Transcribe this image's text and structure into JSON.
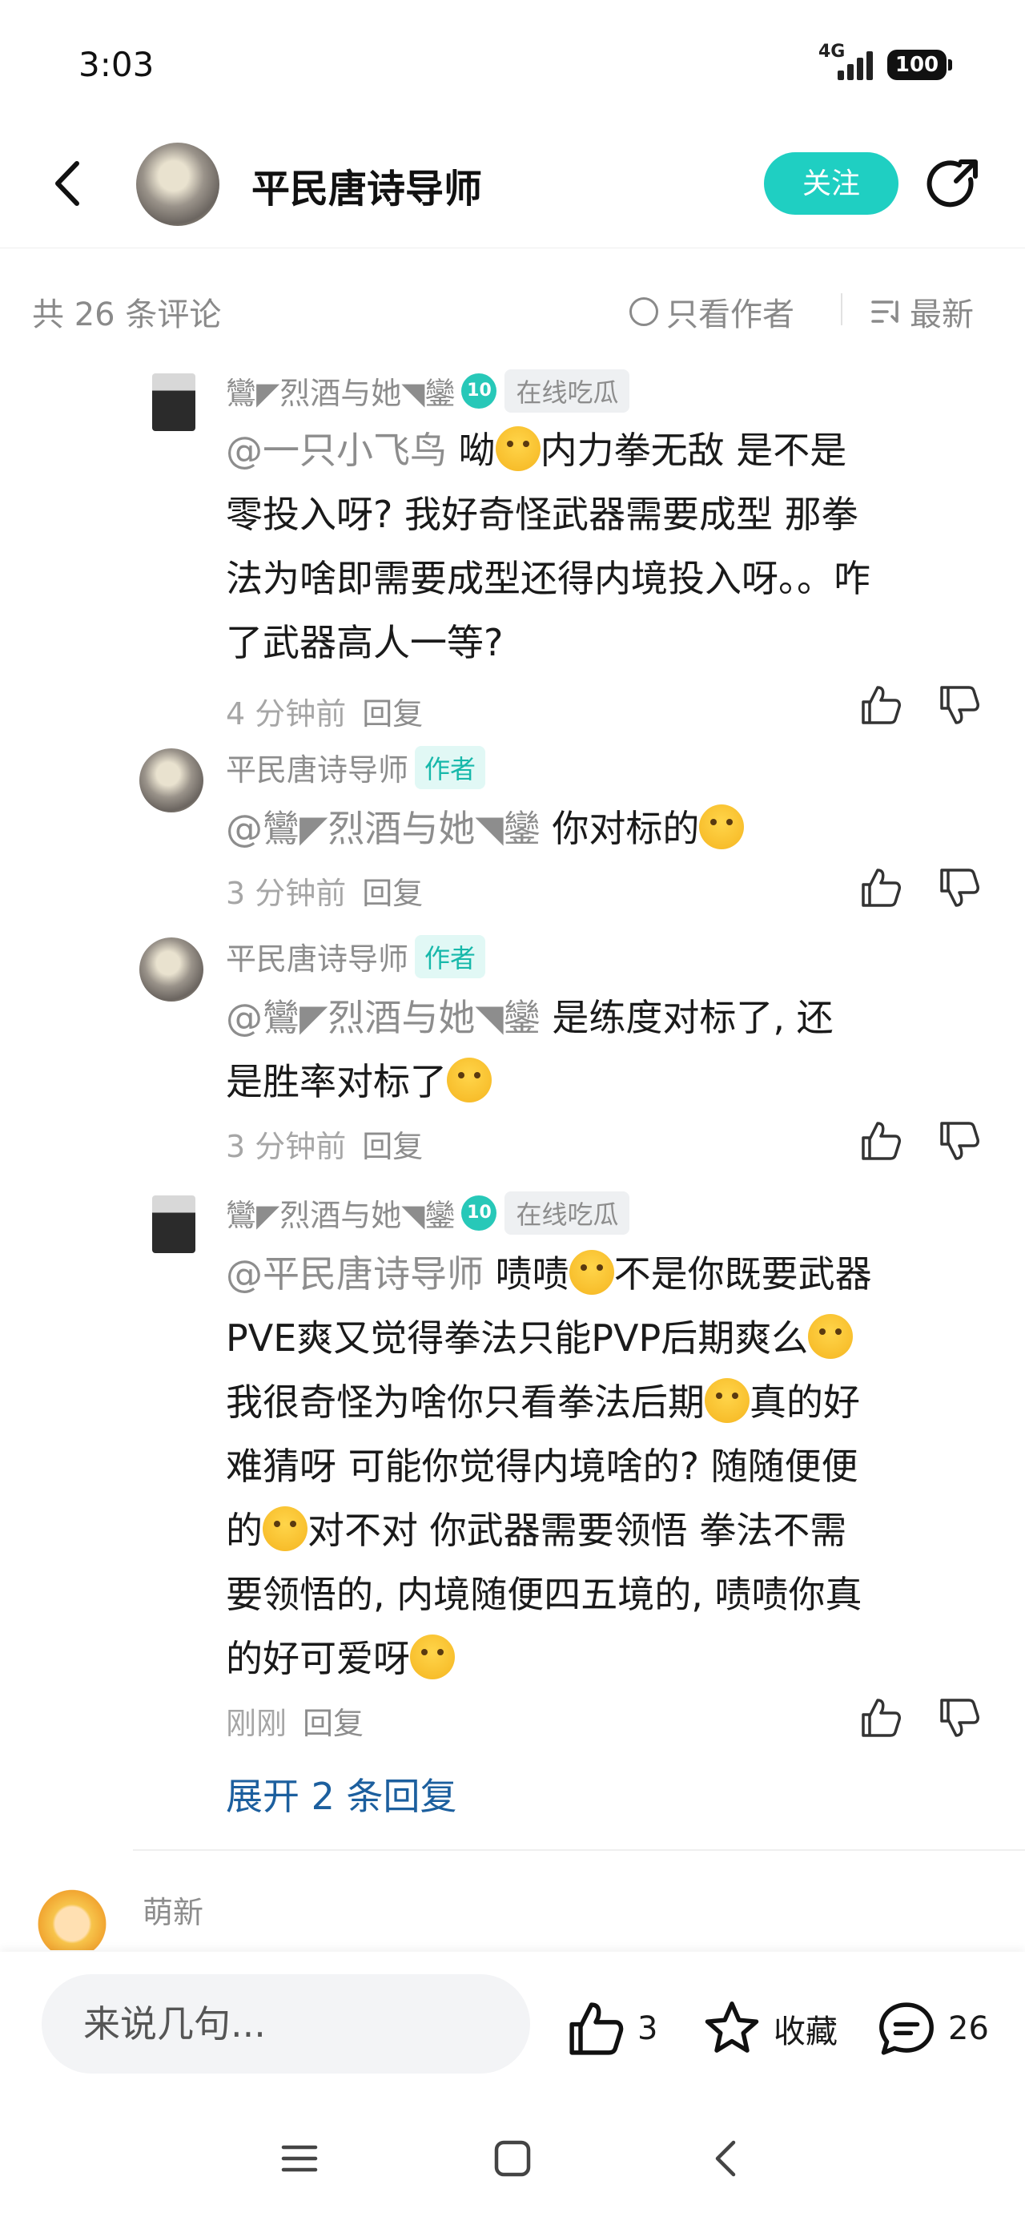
{
  "status": {
    "time": "3:03",
    "network": "4G",
    "battery": "100"
  },
  "header": {
    "title": "平民唐诗导师",
    "follow_label": "关注"
  },
  "filters": {
    "count": "共 26 条评论",
    "only_author": "只看作者",
    "sort": "最新"
  },
  "comments": [
    {
      "user": "鸞◤烈酒与她◥鑾",
      "level": "10",
      "tag": "在线吃瓜",
      "mention": "@一只小飞鸟",
      "lines": [
        "  呦",
        "内力拳无敌  是不是",
        "零投入呀? 我好奇怪武器需要成型  那拳",
        "法为啥即需要成型还得内境投入呀。。咋",
        "了武器高人一等?"
      ],
      "time": "4 分钟前",
      "reply": "回复"
    },
    {
      "user": "平民唐诗导师",
      "tag": "作者",
      "mention": "@鸞◤烈酒与她◥鑾",
      "lines": [
        "  你对标的"
      ],
      "time": "3 分钟前",
      "reply": "回复"
    },
    {
      "user": "平民唐诗导师",
      "tag": "作者",
      "mention": "@鸞◤烈酒与她◥鑾",
      "lines": [
        "  是练度对标了, 还",
        "是胜率对标了"
      ],
      "time": "3 分钟前",
      "reply": "回复"
    },
    {
      "user": "鸞◤烈酒与她◥鑾",
      "level": "10",
      "tag": "在线吃瓜",
      "mention": "@平民唐诗导师",
      "lines": [
        "  啧啧",
        "不是你既要武器",
        "PVE爽又觉得拳法只能PVP后期爽么",
        "我很奇怪为啥你只看拳法后期",
        "真的好",
        "难猜呀  可能你觉得内境啥的? 随随便便",
        "的",
        "对不对  你武器需要领悟  拳法不需",
        "要领悟的, 内境随便四五境的, 啧啧你真",
        "的好可爱呀"
      ],
      "time": "刚刚",
      "reply": "回复"
    }
  ],
  "expand_label": "展开 2 条回复",
  "next_comment": {
    "user": "萌新"
  },
  "bottom": {
    "input_placeholder": "来说几句...",
    "likes": "3",
    "favorite": "收藏",
    "comments": "26"
  }
}
